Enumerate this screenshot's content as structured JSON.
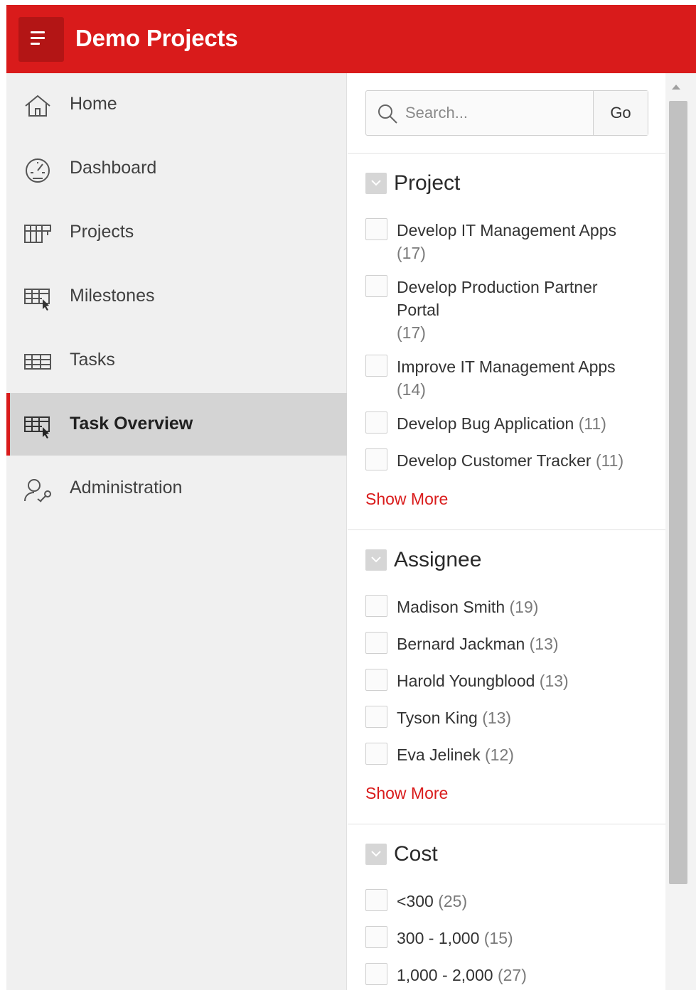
{
  "header": {
    "title": "Demo Projects"
  },
  "sidebar": {
    "items": [
      {
        "label": "Home",
        "icon": "home-icon",
        "active": false
      },
      {
        "label": "Dashboard",
        "icon": "dashboard-icon",
        "active": false
      },
      {
        "label": "Projects",
        "icon": "projects-icon",
        "active": false
      },
      {
        "label": "Milestones",
        "icon": "milestones-icon",
        "active": false
      },
      {
        "label": "Tasks",
        "icon": "tasks-icon",
        "active": false
      },
      {
        "label": "Task Overview",
        "icon": "task-overview-icon",
        "active": true
      },
      {
        "label": "Administration",
        "icon": "administration-icon",
        "active": false
      }
    ]
  },
  "search": {
    "placeholder": "Search...",
    "go_label": "Go"
  },
  "facets": {
    "project": {
      "title": "Project",
      "options": [
        {
          "label": "Develop IT Management Apps",
          "count": "(17)"
        },
        {
          "label": "Develop Production Partner Portal",
          "count": "(17)"
        },
        {
          "label": "Improve IT Management Apps",
          "count": "(14)"
        },
        {
          "label": "Develop Bug Application",
          "count": "(11)"
        },
        {
          "label": "Develop Customer Tracker",
          "count": "(11)"
        }
      ],
      "show_more": "Show More"
    },
    "assignee": {
      "title": "Assignee",
      "options": [
        {
          "label": "Madison Smith",
          "count": "(19)"
        },
        {
          "label": "Bernard Jackman",
          "count": "(13)"
        },
        {
          "label": "Harold Youngblood",
          "count": "(13)"
        },
        {
          "label": "Tyson King",
          "count": "(13)"
        },
        {
          "label": "Eva Jelinek",
          "count": "(12)"
        }
      ],
      "show_more": "Show More"
    },
    "cost": {
      "title": "Cost",
      "options": [
        {
          "label": "<300",
          "count": "(25)"
        },
        {
          "label": "300 - 1,000",
          "count": "(15)"
        },
        {
          "label": "1,000 - 2,000",
          "count": "(27)"
        }
      ]
    }
  },
  "colors": {
    "brand": "#d91b1b",
    "brand_dark": "#b31515",
    "sidebar_bg": "#f0f0f0",
    "active_bg": "#d4d4d4"
  }
}
